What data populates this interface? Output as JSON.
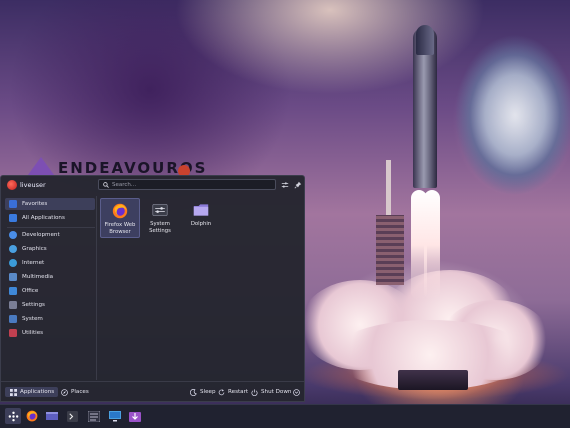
{
  "wallpaper": {
    "logo_text": "ENDEAVOUROS"
  },
  "launcher": {
    "user": {
      "name": "liveuser"
    },
    "search": {
      "placeholder": "Search..."
    },
    "sidebar": {
      "items": [
        {
          "label": "Favorites",
          "icon": "favorites-icon",
          "color": "#3a6fd8"
        },
        {
          "label": "All Applications",
          "icon": "grid-icon",
          "color": "#3a7be0"
        },
        {
          "label": "Development",
          "icon": "development-icon",
          "color": "#4a8ee8"
        },
        {
          "label": "Graphics",
          "icon": "graphics-icon",
          "color": "#4aa0e0"
        },
        {
          "label": "Internet",
          "icon": "internet-icon",
          "color": "#3b9bd8"
        },
        {
          "label": "Multimedia",
          "icon": "multimedia-icon",
          "color": "#5a8ac8"
        },
        {
          "label": "Office",
          "icon": "office-icon",
          "color": "#3f88d8"
        },
        {
          "label": "Settings",
          "icon": "settings-icon",
          "color": "#7a7e96"
        },
        {
          "label": "System",
          "icon": "system-icon",
          "color": "#4a7ac0"
        },
        {
          "label": "Utilities",
          "icon": "utilities-icon",
          "color": "#c04050"
        }
      ]
    },
    "apps": [
      {
        "label": "Firefox Web Browser",
        "icon": "firefox-icon"
      },
      {
        "label": "System Settings",
        "icon": "system-settings-icon"
      },
      {
        "label": "Dolphin",
        "icon": "folder-icon"
      }
    ],
    "footer": {
      "applications_label": "Applications",
      "places_label": "Places",
      "sleep_label": "Sleep",
      "restart_label": "Restart",
      "shutdown_label": "Shut Down"
    }
  },
  "taskbar": {
    "items": [
      "app-launcher-icon",
      "firefox-icon",
      "pager-icon",
      "terminal-icon",
      "system-monitor-icon",
      "display-icon",
      "installer-icon"
    ]
  },
  "colors": {
    "panel_bg": "#252630",
    "selection": "#3d3f5a",
    "accent": "#3a7be0"
  }
}
